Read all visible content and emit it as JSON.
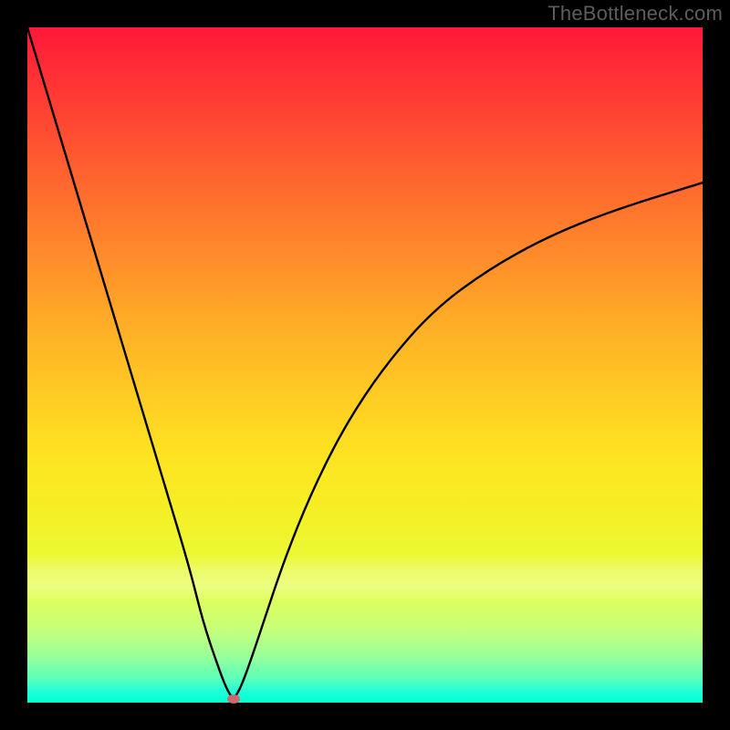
{
  "watermark": "TheBottleneck.com",
  "chart_data": {
    "type": "line",
    "title": "",
    "xlabel": "",
    "ylabel": "",
    "xlim": [
      0,
      100
    ],
    "ylim": [
      0,
      100
    ],
    "grid": false,
    "legend": false,
    "background_gradient": {
      "direction": "vertical",
      "stops": [
        {
          "pos": 0,
          "color": "#ff1838"
        },
        {
          "pos": 50,
          "color": "#ffc024"
        },
        {
          "pos": 80,
          "color": "#f2f82e"
        },
        {
          "pos": 100,
          "color": "#00ffd0"
        }
      ]
    },
    "series": [
      {
        "name": "bottleneck-curve",
        "x": [
          0,
          3,
          6,
          9,
          12,
          15,
          18,
          21,
          24,
          26,
          28,
          29.5,
          30.5,
          31.5,
          33,
          35,
          38,
          42,
          47,
          53,
          60,
          68,
          77,
          87,
          100
        ],
        "y": [
          100,
          90,
          80,
          70,
          60,
          50,
          40,
          30,
          20,
          12,
          6,
          2,
          0.5,
          2,
          6,
          12,
          21,
          31,
          41,
          50,
          58,
          64,
          69,
          73,
          77
        ]
      }
    ],
    "annotations": [
      {
        "name": "optimal-point-marker",
        "x": 30.5,
        "y": 0.5,
        "color": "#cd696e",
        "shape": "ellipse"
      }
    ]
  }
}
